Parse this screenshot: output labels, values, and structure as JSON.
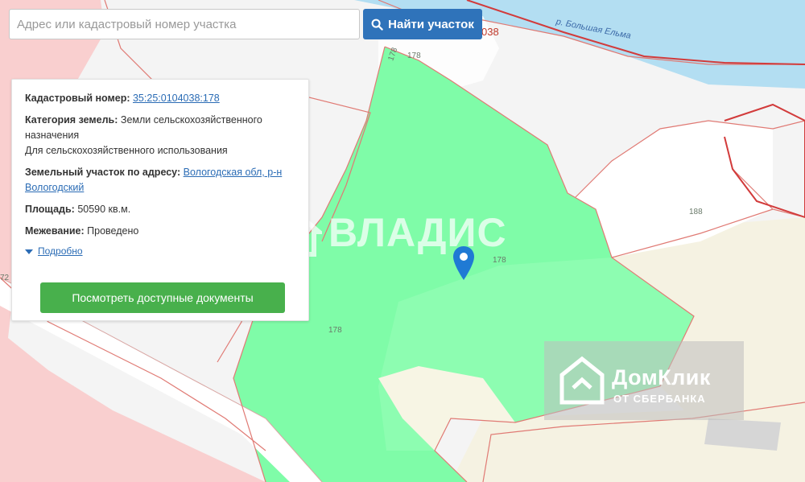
{
  "search": {
    "placeholder": "Адрес или кадастровый номер участка",
    "button_label": "Найти участок",
    "button_icon": "search-icon"
  },
  "info": {
    "cadastral_label": "Кадастровый номер:",
    "cadastral_value": "35:25:0104038:178",
    "category_label": "Категория земель:",
    "category_value": "Земли сельскохозяйственного назначения",
    "category_use": "Для сельскохозяйственного использования",
    "address_label": "Земельный участок по адресу:",
    "address_value": "Вологодская обл, р-н Вологодский",
    "area_label": "Площадь:",
    "area_value": "50590 кв.м.",
    "survey_label": "Межевание:",
    "survey_value": "Проведено",
    "more_label": "Подробно",
    "docs_button": "Посмотреть доступные документы"
  },
  "map": {
    "river_name": "р. Большая Ельма",
    "parcel_labels": [
      "178",
      "178",
      "178",
      "178",
      "188",
      "038",
      "72"
    ],
    "colors": {
      "selected_parcel": "#7ffca8",
      "pink_zone": "#f9cfcf",
      "river": "#b3def2",
      "land": "#f4f4f4",
      "beige": "#f5f2e2",
      "boundary": "#e07a74",
      "marker": "#1f7ad4"
    }
  },
  "watermarks": {
    "vladis": "ВЛАДИС",
    "domclick_name": "ДомКлик",
    "domclick_sub": "ОТ СБЕРБАНКА"
  }
}
